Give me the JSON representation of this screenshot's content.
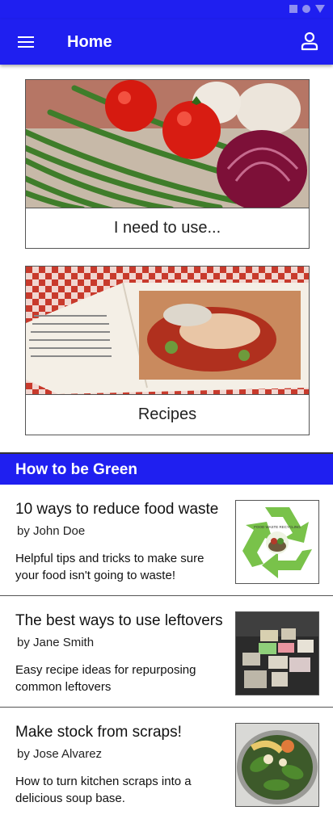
{
  "app_bar": {
    "title": "Home"
  },
  "cards": [
    {
      "label": "I need to use..."
    },
    {
      "label": "Recipes"
    }
  ],
  "section": {
    "title": "How to be Green"
  },
  "articles": [
    {
      "title": "10 ways to reduce food waste",
      "author": "by John Doe",
      "description": "Helpful tips and tricks to make sure your food isn't going to waste!",
      "thumbnail": "recycling-logo-image"
    },
    {
      "title": "The best ways to use leftovers",
      "author": "by Jane Smith",
      "description": "Easy recipe ideas for repurposing common leftovers",
      "thumbnail": "leftover-containers-image"
    },
    {
      "title": "Make stock from scraps!",
      "author": "by Jose Alvarez",
      "description": "How to turn kitchen scraps into a delicious soup base.",
      "thumbnail": "vegetable-scraps-pot-image"
    }
  ],
  "icons": {
    "menu": "hamburger-menu-icon",
    "account": "account-icon"
  },
  "colors": {
    "primary": "#1f1ff0"
  }
}
